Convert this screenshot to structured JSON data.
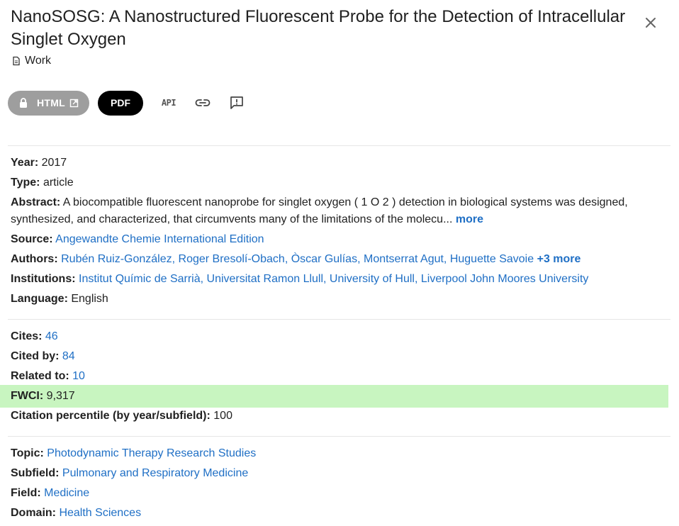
{
  "header": {
    "title": "NanoSOSG: A Nanostructured Fluorescent Probe for the Detection of Intracellular Singlet Oxygen",
    "type_label": "Work",
    "close_icon": "close-icon",
    "type_icon": "document-icon"
  },
  "actions": {
    "html_label": "HTML",
    "pdf_label": "PDF",
    "api_label": "API",
    "icons": [
      "lock-icon",
      "external-link-icon",
      "link-icon",
      "report-icon"
    ]
  },
  "details": {
    "year_label": "Year:",
    "year": "2017",
    "type_label": "Type:",
    "type": "article",
    "abstract_label": "Abstract:",
    "abstract_text": "A biocompatible fluorescent nanoprobe for singlet oxygen ( 1 O 2 ) detection in biological systems was designed, synthesized, and characterized, that circumvents many of the limitations of the molecu...",
    "abstract_more": "more",
    "source_label": "Source:",
    "source": "Angewandte Chemie International Edition",
    "authors_label": "Authors:",
    "authors": [
      "Rubén Ruiz-González,",
      "Roger Bresolí-Obach,",
      "Òscar Gulías,",
      "Montserrat Agut,",
      "Huguette Savoie"
    ],
    "authors_more": "+3 more",
    "institutions_label": "Institutions:",
    "institutions": [
      "Institut Químic de Sarrià,",
      "Universitat Ramon Llull,",
      "University of Hull,",
      "Liverpool John Moores University"
    ],
    "language_label": "Language:",
    "language": "English"
  },
  "metrics": {
    "cites_label": "Cites:",
    "cites": "46",
    "cited_by_label": "Cited by:",
    "cited_by": "84",
    "related_label": "Related to:",
    "related": "10",
    "fwci_label": "FWCI:",
    "fwci": "9,317",
    "percentile_label": "Citation percentile (by year/subfield):",
    "percentile": "100",
    "highlight_color": "#c8f5c0"
  },
  "topics": {
    "topic_label": "Topic:",
    "topic": "Photodynamic Therapy Research Studies",
    "subfield_label": "Subfield:",
    "subfield": "Pulmonary and Respiratory Medicine",
    "field_label": "Field:",
    "field": "Medicine",
    "domain_label": "Domain:",
    "domain": "Health Sciences"
  },
  "colors": {
    "link": "#1f6fc5",
    "text": "#212121"
  }
}
